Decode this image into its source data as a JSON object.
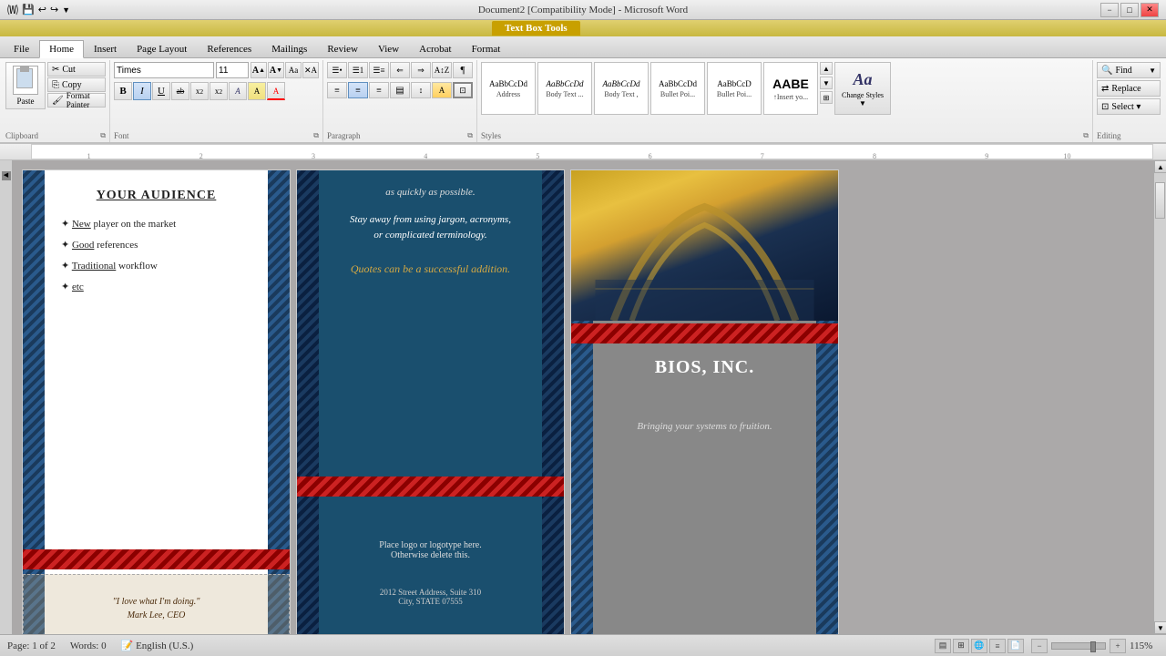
{
  "titlebar": {
    "title": "Document2 [Compatibility Mode] - Microsoft Word",
    "controls": [
      "−",
      "□",
      "✕"
    ]
  },
  "tabs": {
    "textbox_tab": "Text Box Tools",
    "items": [
      "File",
      "Home",
      "Insert",
      "Page Layout",
      "References",
      "Mailings",
      "Review",
      "View",
      "Acrobat",
      "Format"
    ]
  },
  "ribbon": {
    "clipboard": {
      "label": "Clipboard",
      "paste": "Paste",
      "cut": "Cut",
      "copy": "Copy",
      "format_painter": "Format Painter"
    },
    "font": {
      "label": "Font",
      "font_name": "Times",
      "font_size": "11",
      "bold": "B",
      "italic": "I",
      "underline": "U",
      "strikethrough": "ab̶",
      "subscript": "x₂",
      "superscript": "x²",
      "grow": "A",
      "shrink": "A",
      "case": "Aa"
    },
    "paragraph": {
      "label": "Paragraph"
    },
    "styles": {
      "label": "Styles",
      "items": [
        {
          "name": "Address",
          "preview": "AaBbCcDd"
        },
        {
          "name": "Body Text ...",
          "preview": "AaBbCcDd"
        },
        {
          "name": "Body Text ,",
          "preview": "AaBbCcDd"
        },
        {
          "name": "Bullet Poi...",
          "preview": "AaBbCcDd"
        },
        {
          "name": "Bullet Poi...",
          "preview": "AaBbCcD"
        },
        {
          "name": "↑Insert yo...",
          "preview": "AABE"
        }
      ],
      "change_styles": "Change Styles",
      "change_styles_arrow": "▼"
    },
    "editing": {
      "label": "Editing",
      "find": "Find",
      "replace": "Replace",
      "select": "Select ▾"
    }
  },
  "document": {
    "panel1": {
      "heading": "YOUR AUDIENCE",
      "bullets": [
        "✦ New player on the market",
        "✦ Good references",
        "✦ Traditional workflow",
        "✦ etc"
      ],
      "quote": "\"I love what I'm doing.\"",
      "quote_author": "Mark Lee, CEO"
    },
    "panel2": {
      "text1": "as quickly as possible.",
      "text2": "Stay away from using jargon, acronyms,\nor complicated terminology.",
      "quote": "Quotes can be a successful addition.",
      "logo_text": "Place logo  or logotype here.\nOtherwise delete this.",
      "address1": "2012 Street Address,  Suite 310",
      "address2": "City, STATE 07555"
    },
    "panel3": {
      "company": "BIOS, INC.",
      "tagline": "Bringing your systems to fruition."
    }
  },
  "statusbar": {
    "page": "Page: 1 of 2",
    "words": "Words: 0",
    "language": "English (U.S.)",
    "zoom": "115%"
  }
}
